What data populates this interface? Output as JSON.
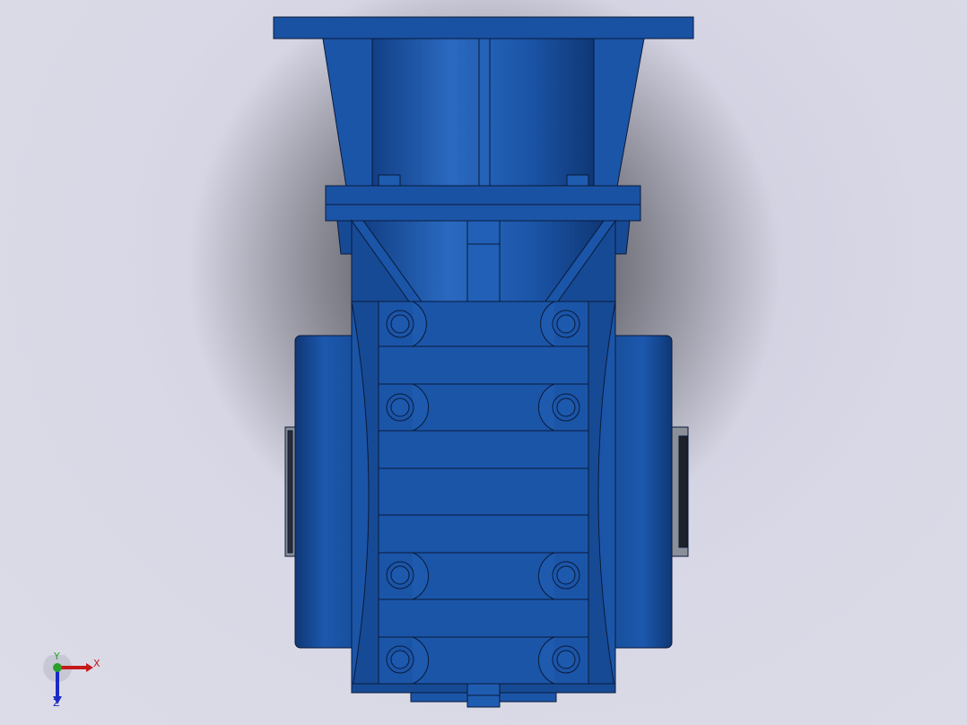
{
  "viewport": {
    "background_color": "#d6d6e4",
    "model_color": "#1b55a8",
    "outline_color": "#0a1a3a"
  },
  "axis_triad": {
    "x_label": "X",
    "y_label": "Y",
    "z_label": "Z",
    "x_color": "#c41a1a",
    "y_color": "#2aa02a",
    "z_color": "#1a2ac4"
  }
}
